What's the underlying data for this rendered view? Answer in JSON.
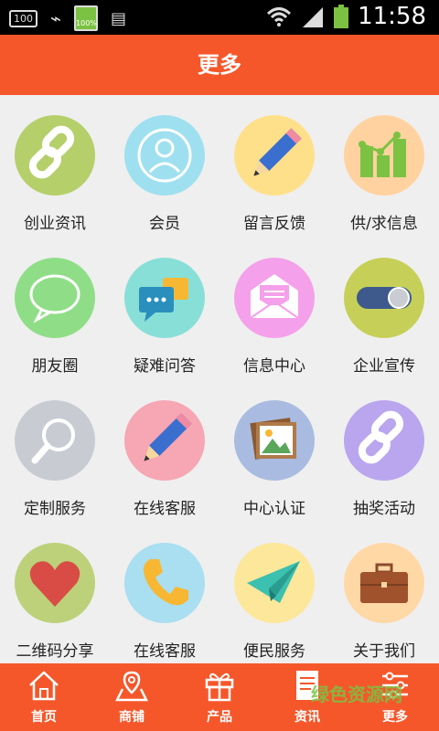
{
  "status_bar": {
    "left_icons": [
      "sim-100-icon",
      "usb-icon",
      "battery-100-icon",
      "notification-icon"
    ],
    "sim_label": "100",
    "battery_small_label": "100%",
    "time": "11:58"
  },
  "header": {
    "title": "更多"
  },
  "grid": {
    "items": [
      {
        "label": "创业资讯",
        "icon": "link-icon",
        "color": "#b5cf6b"
      },
      {
        "label": "会员",
        "icon": "user-icon",
        "color": "#9ee0ef"
      },
      {
        "label": "留言反馈",
        "icon": "pencil-icon",
        "color": "#ffe08a"
      },
      {
        "label": "供/求信息",
        "icon": "bar-chart-icon",
        "color": "#ffd2a0"
      },
      {
        "label": "朋友圈",
        "icon": "chat-bubble-icon",
        "color": "#8fde87"
      },
      {
        "label": "疑难问答",
        "icon": "chat-bubbles-icon",
        "color": "#88dfd8"
      },
      {
        "label": "信息中心",
        "icon": "envelope-icon",
        "color": "#f5a0ea"
      },
      {
        "label": "企业宣传",
        "icon": "toggle-icon",
        "color": "#c6cf58"
      },
      {
        "label": "定制服务",
        "icon": "magnifier-icon",
        "color": "#c8ccd2"
      },
      {
        "label": "在线客服",
        "icon": "pencil-icon",
        "color": "#f7a6b3"
      },
      {
        "label": "中心认证",
        "icon": "picture-icon",
        "color": "#a9bbe0"
      },
      {
        "label": "抽奖活动",
        "icon": "link-icon",
        "color": "#b9a6ee"
      },
      {
        "label": "二维码分享",
        "icon": "heart-icon",
        "color": "#bcd17a"
      },
      {
        "label": "在线客服",
        "icon": "phone-icon",
        "color": "#a9dff0"
      },
      {
        "label": "便民服务",
        "icon": "paper-plane-icon",
        "color": "#fde79a"
      },
      {
        "label": "关于我们",
        "icon": "briefcase-icon",
        "color": "#ffd8a6"
      }
    ]
  },
  "tabbar": {
    "tabs": [
      {
        "label": "首页",
        "icon": "home-icon"
      },
      {
        "label": "商铺",
        "icon": "map-location-icon"
      },
      {
        "label": "产品",
        "icon": "gift-icon"
      },
      {
        "label": "资讯",
        "icon": "document-icon"
      },
      {
        "label": "更多",
        "icon": "sliders-icon"
      }
    ]
  },
  "watermark": "绿色资源网",
  "colors": {
    "accent": "#f5572b",
    "background": "#efefef"
  }
}
